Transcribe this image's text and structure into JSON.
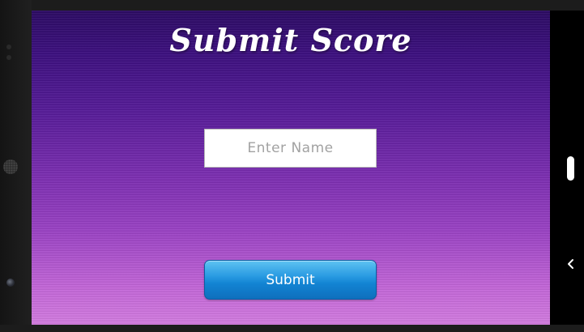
{
  "title": "Submit Score",
  "name_input": {
    "placeholder": "Enter Name",
    "value": ""
  },
  "submit_button": {
    "label": "Submit"
  },
  "colors": {
    "background_top": "#2b0a63",
    "background_bottom": "#d37ce0",
    "button_blue": "#1284d3",
    "input_border": "#b9b9b9"
  },
  "icons": {
    "nav_back": "chevron-left-icon",
    "scroll_indicator": "scroll-pill"
  }
}
